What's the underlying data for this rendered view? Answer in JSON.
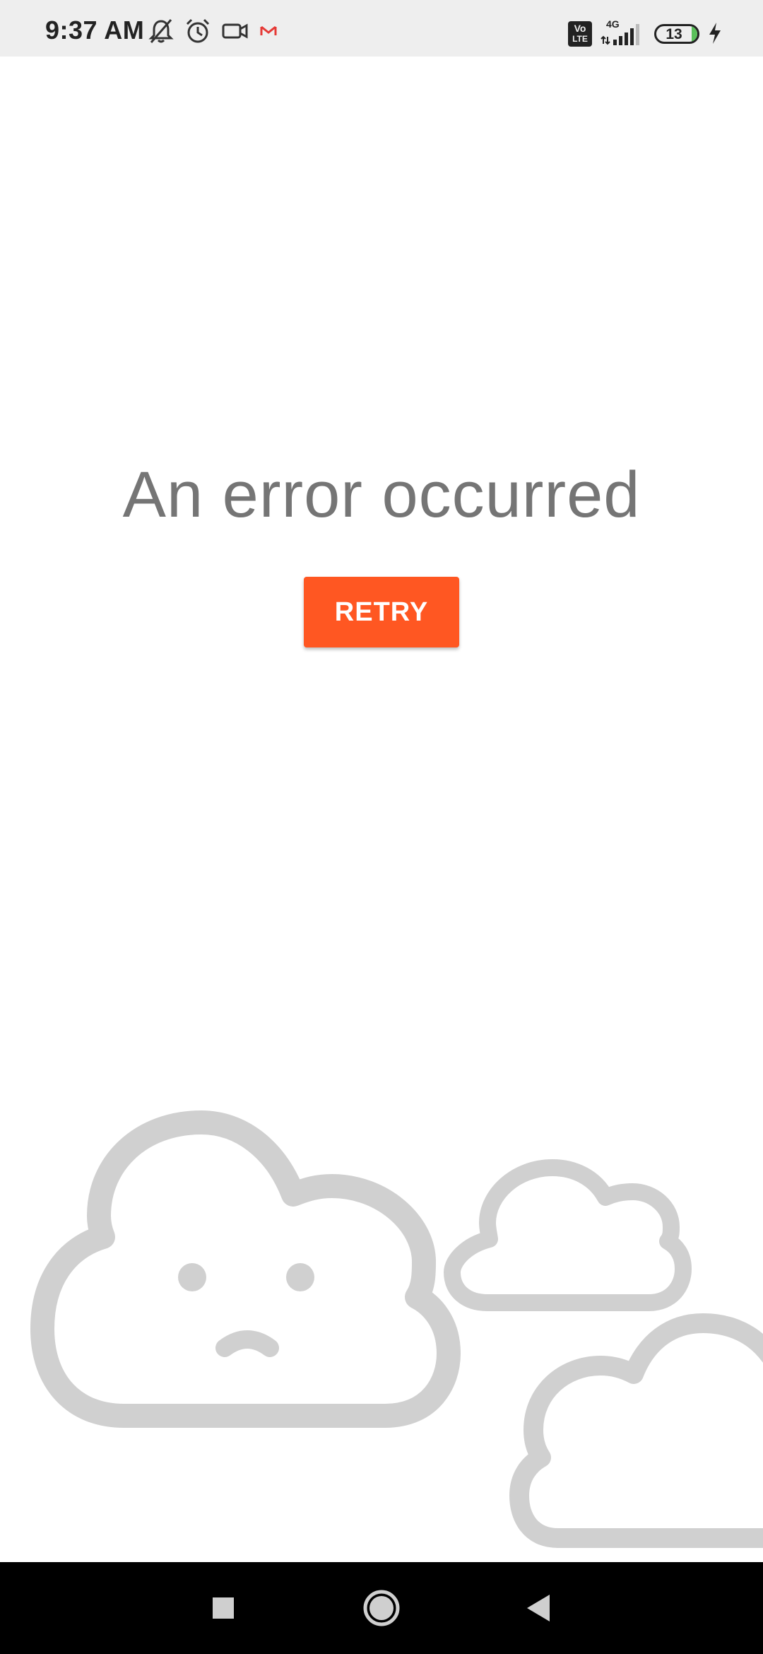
{
  "status_bar": {
    "time": "9:37 AM",
    "icons_left": [
      "muted-bell-icon",
      "alarm-icon",
      "video-camera-icon",
      "gmail-icon"
    ],
    "icons_right": [
      "volte-icon",
      "signal-4g-icon",
      "battery-icon",
      "charging-icon"
    ],
    "network_label": "4G",
    "volte_label_top": "Vo",
    "volte_label_bottom": "LTE",
    "battery_level": "13",
    "battery_fraction": 0.13
  },
  "main": {
    "error_message": "An error occurred",
    "retry_label": "RETRY"
  },
  "colors": {
    "accent": "#ff5722",
    "error_text": "#757575",
    "cloud": "#d0d0d0",
    "status_bar_bg": "#eeeeee",
    "nav_bar_bg": "#000000"
  },
  "illustration": {
    "icons": [
      "sad-cloud-icon",
      "small-cloud-icon",
      "partial-cloud-icon"
    ]
  },
  "nav_bar": {
    "buttons": [
      "recents-square-icon",
      "home-circle-icon",
      "back-triangle-icon"
    ]
  }
}
